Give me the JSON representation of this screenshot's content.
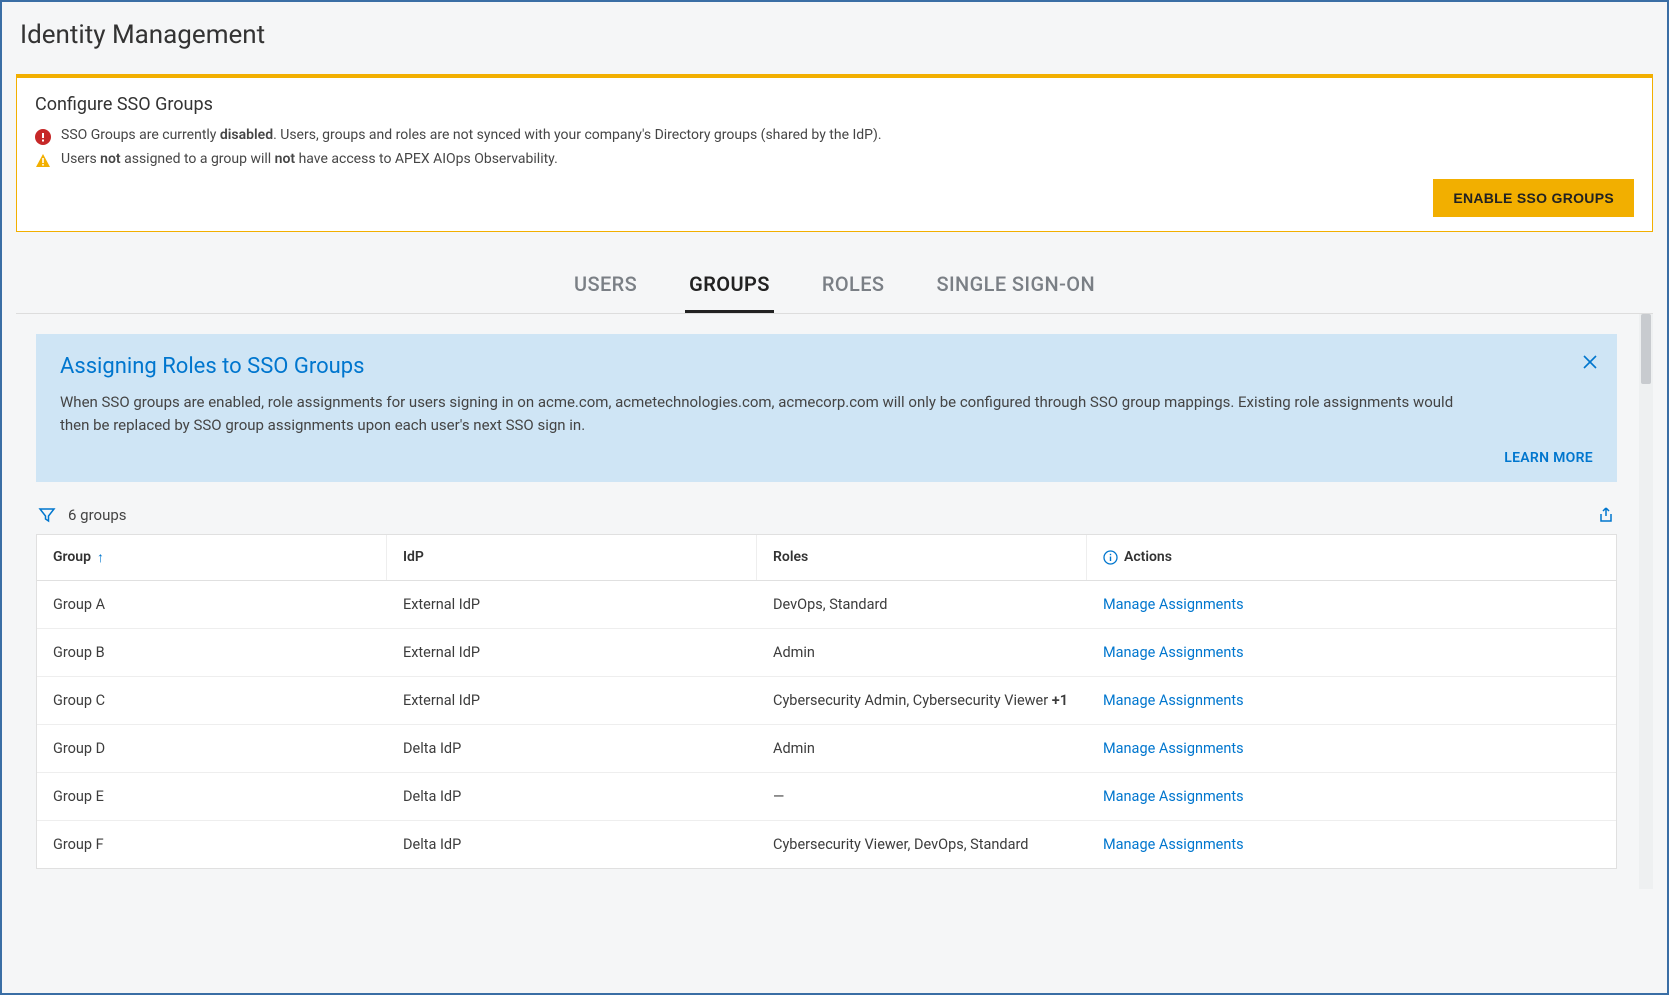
{
  "page": {
    "title": "Identity Management"
  },
  "callout": {
    "title": "Configure SSO Groups",
    "err_prefix": "SSO Groups are currently ",
    "err_bold1": "disabled",
    "err_suffix": ". Users, groups and roles are not synced with your company's Directory groups (shared by the IdP).",
    "warn_prefix": "Users ",
    "warn_bold1": "not",
    "warn_mid": " assigned to a group will ",
    "warn_bold2": "not",
    "warn_suffix": " have access to APEX AIOps Observability.",
    "enable_btn": "ENABLE SSO GROUPS"
  },
  "tabs": {
    "users": "USERS",
    "groups": "GROUPS",
    "roles": "ROLES",
    "sso": "SINGLE SIGN-ON"
  },
  "banner": {
    "title": "Assigning Roles to SSO Groups",
    "body": "When SSO groups are enabled, role assignments for users signing in on acme.com, acmetechnologies.com, acmecorp.com will only be configured through SSO group mappings. Existing role assignments would then be replaced by SSO group assignments upon each user's next SSO sign in.",
    "learn_more": "LEARN MORE"
  },
  "toolbar": {
    "count_label": "6 groups"
  },
  "table": {
    "col_group": "Group",
    "col_idp": "IdP",
    "col_roles": "Roles",
    "col_actions": "Actions",
    "manage_label": "Manage Assignments",
    "rows": [
      {
        "group": "Group A",
        "idp": "External IdP",
        "roles": "DevOps, Standard"
      },
      {
        "group": "Group B",
        "idp": "External IdP",
        "roles": "Admin"
      },
      {
        "group": "Group C",
        "idp": "External IdP",
        "roles": "Cybersecurity Admin, Cybersecurity Viewer ",
        "roles_more": "+1"
      },
      {
        "group": "Group D",
        "idp": "Delta IdP",
        "roles": "Admin"
      },
      {
        "group": "Group E",
        "idp": "Delta IdP",
        "roles": "—"
      },
      {
        "group": "Group F",
        "idp": "Delta IdP",
        "roles": "Cybersecurity Viewer, DevOps, Standard"
      }
    ]
  }
}
